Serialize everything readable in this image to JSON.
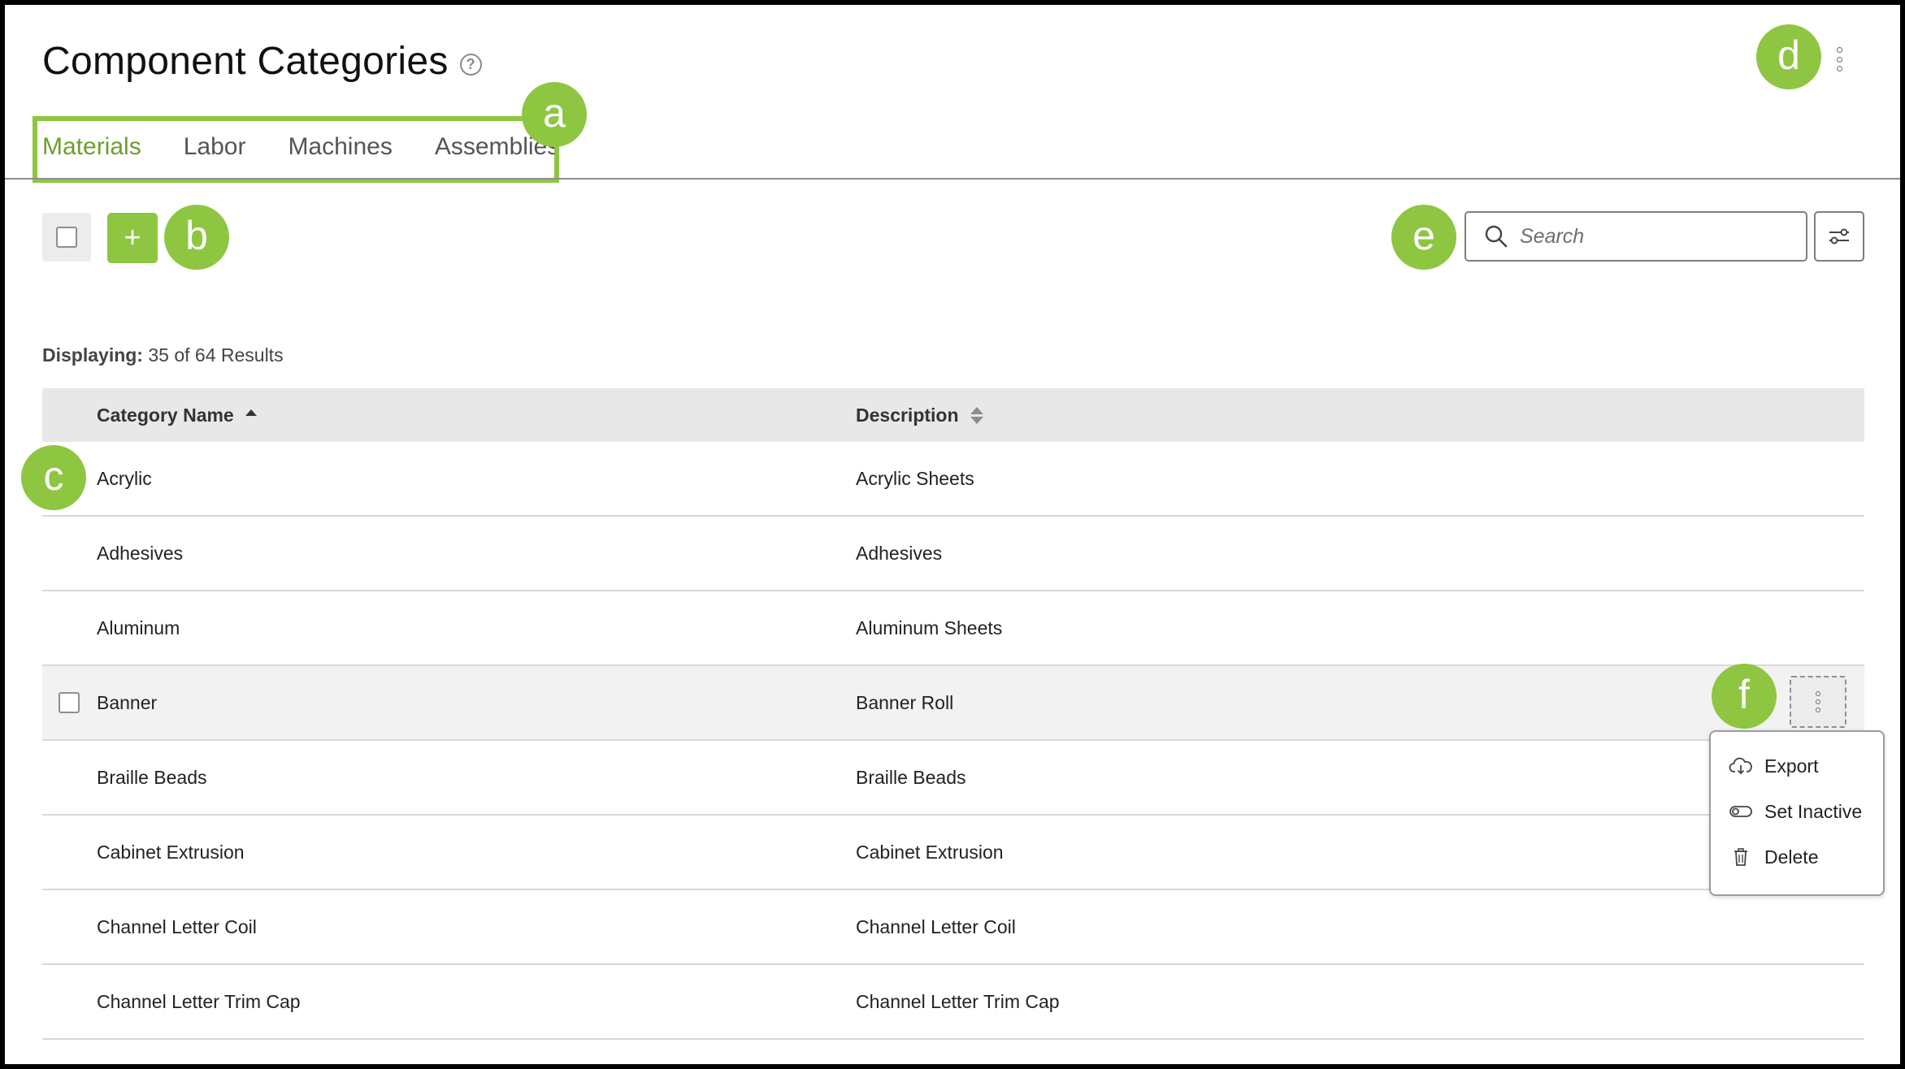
{
  "header": {
    "title": "Component Categories",
    "help_icon": "question-circle-icon",
    "more_icon": "kebab-vertical-icon"
  },
  "tabs": [
    {
      "label": "Materials",
      "active": true
    },
    {
      "label": "Labor",
      "active": false
    },
    {
      "label": "Machines",
      "active": false
    },
    {
      "label": "Assemblies",
      "active": false
    }
  ],
  "toolbar": {
    "add_label": "+",
    "search_placeholder": "Search",
    "filter_icon": "filter-sliders-icon"
  },
  "results": {
    "label": "Displaying:",
    "summary": "35 of 64 Results"
  },
  "table": {
    "columns": [
      "Category Name",
      "Description"
    ],
    "rows": [
      {
        "name": "Acrylic",
        "description": "Acrylic Sheets"
      },
      {
        "name": "Adhesives",
        "description": "Adhesives"
      },
      {
        "name": "Aluminum",
        "description": "Aluminum Sheets"
      },
      {
        "name": "Banner",
        "description": "Banner Roll"
      },
      {
        "name": "Braille Beads",
        "description": "Braille Beads"
      },
      {
        "name": "Cabinet Extrusion",
        "description": "Cabinet Extrusion"
      },
      {
        "name": "Channel Letter Coil",
        "description": "Channel Letter Coil"
      },
      {
        "name": "Channel Letter Trim Cap",
        "description": "Channel Letter Trim Cap"
      }
    ]
  },
  "row_menu": {
    "items": [
      {
        "label": "Export",
        "icon": "cloud-download-icon"
      },
      {
        "label": "Set Inactive",
        "icon": "toggle-off-icon"
      },
      {
        "label": "Delete",
        "icon": "trash-icon"
      }
    ]
  },
  "markers": {
    "a": "a",
    "b": "b",
    "c": "c",
    "d": "d",
    "e": "e",
    "f": "f"
  },
  "colors": {
    "accent": "#8ec641",
    "active_tab": "#6d9e2e",
    "header_bg": "#e8e8e8"
  }
}
